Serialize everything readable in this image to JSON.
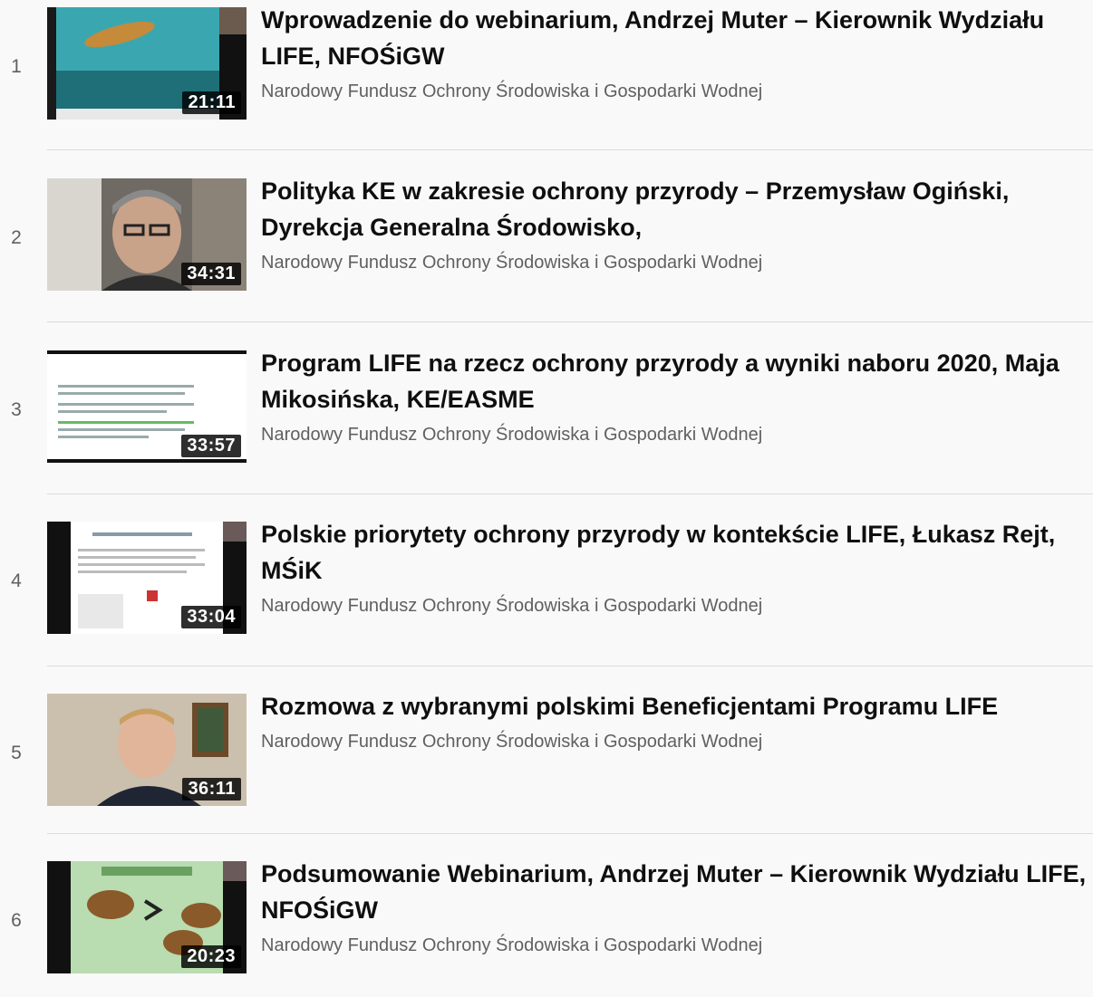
{
  "playlist": {
    "items": [
      {
        "index": "1",
        "title": "Wprowadzenie do webinarium, Andrzej Muter – Kierownik Wydziału LIFE, NFOŚiGW",
        "channel": "Narodowy Fundusz Ochrony Środowiska i Gospodarki Wodnej",
        "duration": "21:11"
      },
      {
        "index": "2",
        "title": "Polityka KE w zakresie ochrony przyrody – Przemysław Ogiński, Dyrekcja Generalna Środowisko,",
        "channel": "Narodowy Fundusz Ochrony Środowiska i Gospodarki Wodnej",
        "duration": "34:31"
      },
      {
        "index": "3",
        "title": "Program LIFE na rzecz ochrony przyrody a wyniki naboru 2020, Maja Mikosińska, KE/EASME",
        "channel": "Narodowy Fundusz Ochrony Środowiska i Gospodarki Wodnej",
        "duration": "33:57"
      },
      {
        "index": "4",
        "title": "Polskie priorytety ochrony przyrody w kontekście LIFE, Łukasz Rejt, MŚiK",
        "channel": "Narodowy Fundusz Ochrony Środowiska i Gospodarki Wodnej",
        "duration": "33:04"
      },
      {
        "index": "5",
        "title": "Rozmowa z wybranymi polskimi Beneficjentami Programu LIFE",
        "channel": "Narodowy Fundusz Ochrony Środowiska i Gospodarki Wodnej",
        "duration": "36:11"
      },
      {
        "index": "6",
        "title": "Podsumowanie Webinarium, Andrzej Muter – Kierownik Wydziału LIFE, NFOŚiGW",
        "channel": "Narodowy Fundusz Ochrony Środowiska i Gospodarki Wodnej",
        "duration": "20:23"
      }
    ]
  }
}
